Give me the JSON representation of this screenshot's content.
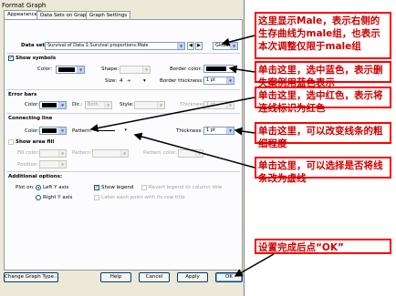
{
  "window": {
    "title": "Format Graph"
  },
  "tabs": [
    {
      "label": "Appearance",
      "active": true
    },
    {
      "label": "Data Sets on Graph"
    },
    {
      "label": "Graph Settings"
    }
  ],
  "dataset": {
    "label": "Data set:",
    "value": "Survival of Data 1:Survival proportions:Male",
    "scope": "Global"
  },
  "symbols": {
    "label": "Show symbols",
    "checked": true,
    "color_label": "Color:",
    "shape_label": "Shape:",
    "size_label": "Size:",
    "size_value": "4",
    "border_color_label": "Border color:",
    "border_thickness_label": "Border thickness:",
    "border_thickness_value": "1 pt",
    "symbol_color": "#000000",
    "border_color": "#000000"
  },
  "error_bars": {
    "title": "Error bars",
    "color_label": "Color:",
    "dir_label": "Dir.:",
    "dir_value": "Both",
    "style_label": "Style:",
    "thickness_label": "Thickness:",
    "thickness_value": "1 pt"
  },
  "connecting_line": {
    "title": "Connecting line",
    "color_label": "Color:",
    "color": "#000000",
    "pattern_label": "Pattern:",
    "thickness_label": "Thickness:",
    "thickness_value": "1 pt"
  },
  "area_fill": {
    "label": "Show area fill",
    "checked": false,
    "fill_color_label": "Fill color:",
    "pattern_label": "Pattern:",
    "pattern_color_label": "Pattern color:",
    "position_label": "Position:"
  },
  "additional": {
    "title": "Additional options:",
    "plot_on_label": "Plot on:",
    "left_axis": "Left Y axis",
    "right_axis": "Right Y axis",
    "show_legend": "Show legend",
    "revert_legend": "Revert legend to column title",
    "label_points": "Label each point with its row title"
  },
  "buttons": {
    "change_type": "Change Graph Type...",
    "help": "Help",
    "cancel": "Cancel",
    "apply": "Apply",
    "ok": "OK"
  },
  "callouts": [
    "这里显示Male，表示右侧的生存曲线为male组，也表示本次调整仅限于male组",
    "单击这里，选中蓝色，表示删失案例用蓝色表示",
    "单击这里，选中红色，表示将连线标识为红色",
    "单击这里，可以改变线条的粗细程度",
    "单击这里，可以选择是否将线条改为虚线",
    "设置完成后点“OK”"
  ],
  "colors": {
    "callout_border": "#ff0000",
    "callout_text": "#cc0000",
    "arrow": "#000000"
  }
}
